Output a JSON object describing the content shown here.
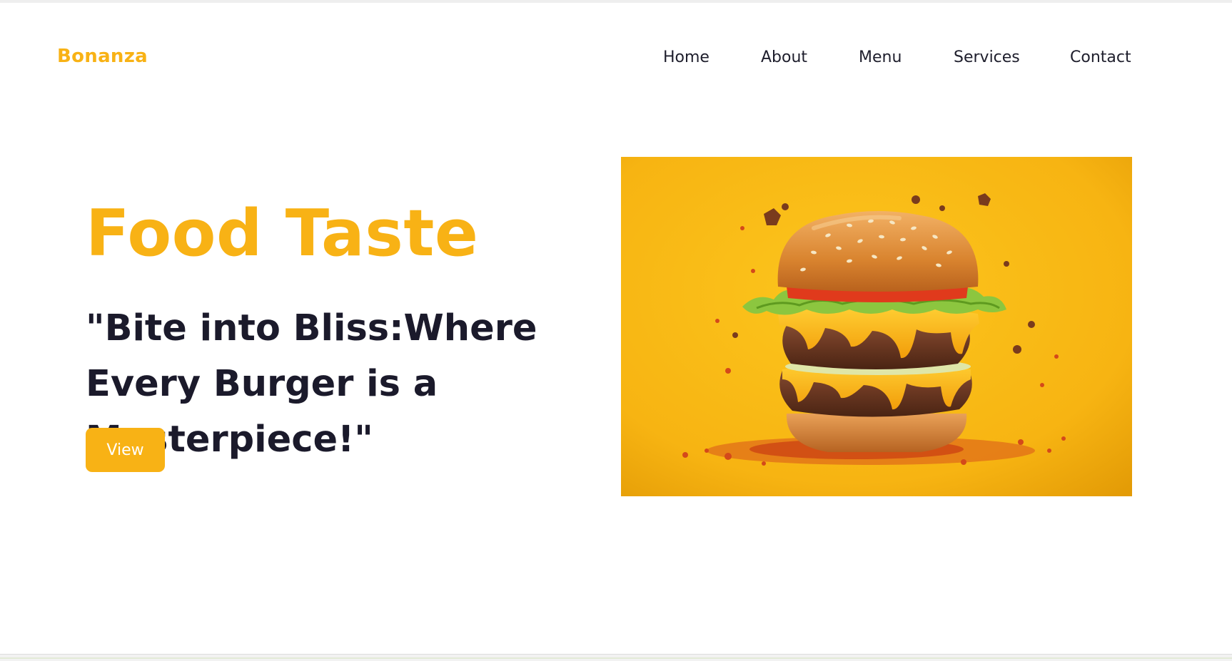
{
  "brand": {
    "name": "Bonanza",
    "color": "#f8b215"
  },
  "nav": {
    "items": [
      {
        "label": "Home"
      },
      {
        "label": "About"
      },
      {
        "label": "Menu"
      },
      {
        "label": "Services"
      },
      {
        "label": "Contact"
      }
    ]
  },
  "hero": {
    "title": "Food Taste",
    "tagline": "\"Bite into Bliss:Where Every Burger is a Masterpiece!\"",
    "button_label": "View",
    "image_subject": "burger-photo",
    "accent_color": "#f8b215",
    "text_color": "#1b1a2b"
  }
}
